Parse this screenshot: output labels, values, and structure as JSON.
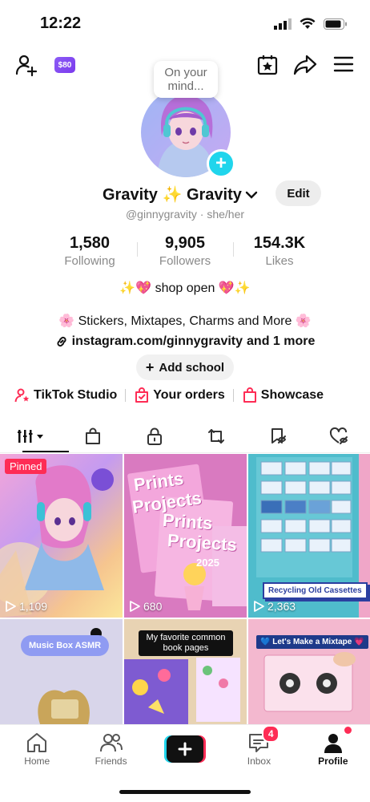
{
  "status": {
    "time": "12:22"
  },
  "top": {
    "coin_badge": "$80",
    "bubble": "On your mind..."
  },
  "profile": {
    "name": "Gravity ✨ Gravity",
    "edit_label": "Edit",
    "handle_line": "@ginnygravity · she/her",
    "stats": [
      {
        "value": "1,580",
        "label": "Following"
      },
      {
        "value": "9,905",
        "label": "Followers"
      },
      {
        "value": "154.3K",
        "label": "Likes"
      }
    ],
    "headline": "✨💖 shop open 💖✨",
    "bio": "🌸 Stickers, Mixtapes, Charms and More 🌸",
    "link": "instagram.com/ginnygravity",
    "link_more": "and 1 more",
    "add_school": "Add school"
  },
  "quick_links": [
    {
      "label": "TikTok Studio",
      "color": "#fe2c55"
    },
    {
      "label": "Your orders",
      "color": "#fe2c55"
    },
    {
      "label": "Showcase",
      "color": "#fe2c55"
    }
  ],
  "tiles": [
    {
      "badge": "Pinned",
      "count": "1,109"
    },
    {
      "count": "680",
      "text1": "Prints",
      "text2": "Projects",
      "year": "2025"
    },
    {
      "count": "2,363",
      "overlay": "Recycling Old Cassettes"
    },
    {
      "overlay": "Music Box ASMR"
    },
    {
      "overlay": "My favorite common book pages"
    },
    {
      "overlay": "💙 Let's Make a Mixtape 💗"
    }
  ],
  "nav": {
    "home": "Home",
    "friends": "Friends",
    "inbox": "Inbox",
    "inbox_badge": "4",
    "profile": "Profile"
  }
}
